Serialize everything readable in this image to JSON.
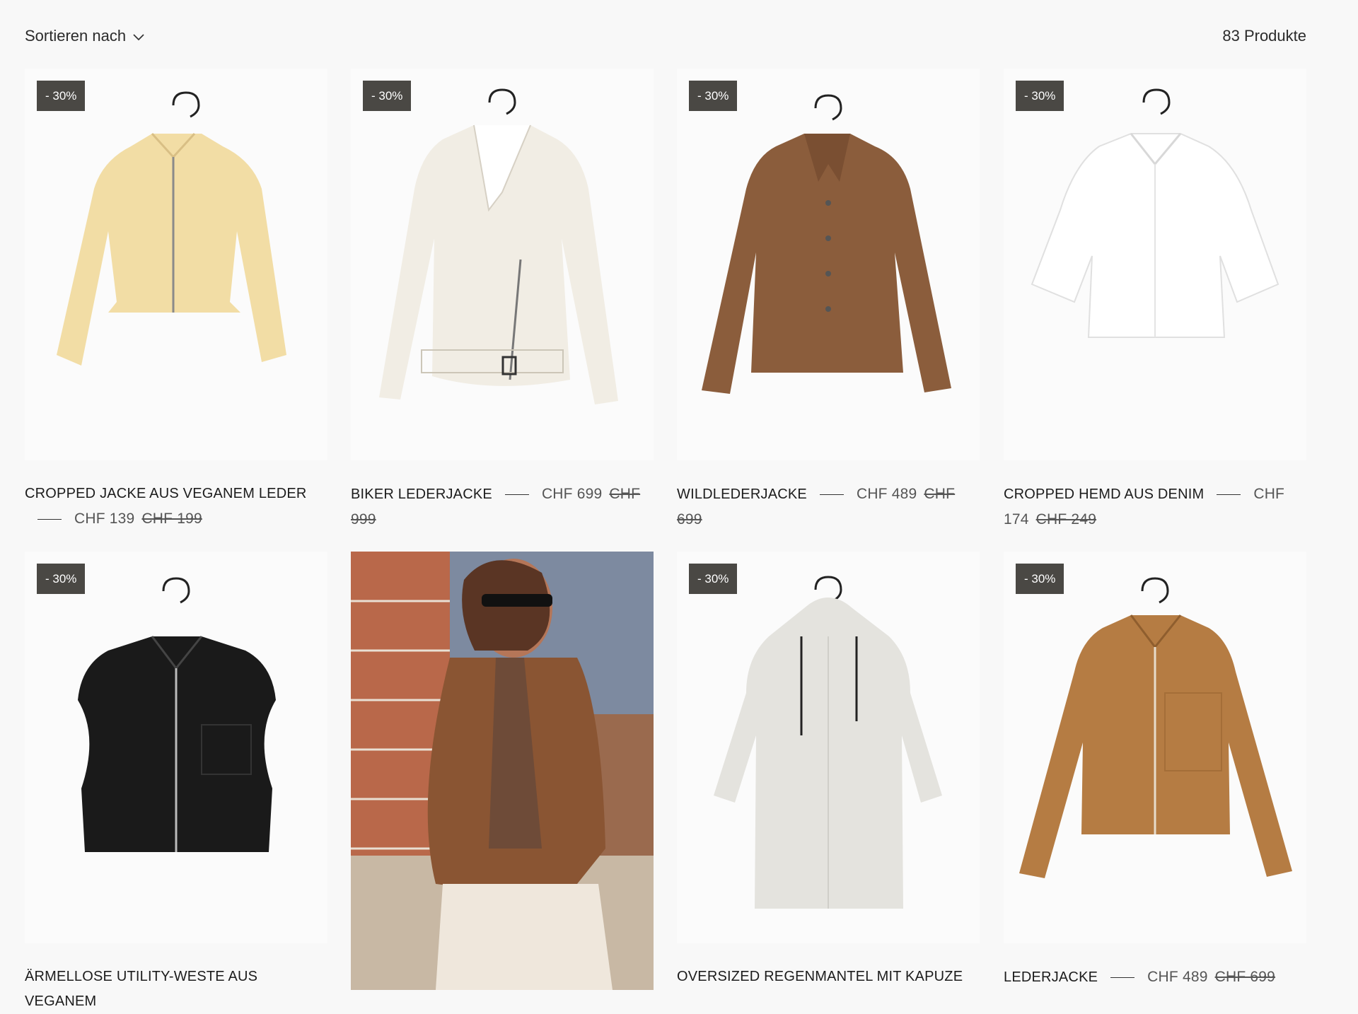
{
  "toolbar": {
    "sort_label": "Sortieren nach",
    "product_count": "83 Produkte"
  },
  "products": [
    {
      "name": "CROPPED JACKE AUS VEGANEM LEDER",
      "price": "CHF 139",
      "old_price": "CHF 199",
      "badge": "- 30%",
      "color": "#f2dda5"
    },
    {
      "name": "BIKER LEDERJACKE",
      "price": "CHF 699",
      "old_price": "CHF 999",
      "badge": "- 30%",
      "color": "#f1ede4"
    },
    {
      "name": "WILDLEDERJACKE",
      "price": "CHF 489",
      "old_price": "CHF 699",
      "badge": "- 30%",
      "color": "#8b5d3c"
    },
    {
      "name": "CROPPED HEMD AUS DENIM",
      "price": "CHF 174",
      "old_price": "CHF 249",
      "badge": "- 30%",
      "color": "#ffffff"
    },
    {
      "name": "ÄRMELLOSE UTILITY-WESTE AUS VEGANEM",
      "price": "",
      "old_price": "",
      "badge": "- 30%",
      "color": "#1a1a1a"
    },
    {
      "name": "OVERSIZED REGENMANTEL MIT KAPUZE",
      "price": "",
      "old_price": "",
      "badge": "- 30%",
      "color": "#e4e3de"
    },
    {
      "name": "LEDERJACKE",
      "price": "CHF 489",
      "old_price": "CHF 699",
      "badge": "- 30%",
      "color": "#b57c43"
    }
  ],
  "lifestyle": {
    "jacket_color": "#8a5533",
    "brick_color": "#b9684a"
  }
}
